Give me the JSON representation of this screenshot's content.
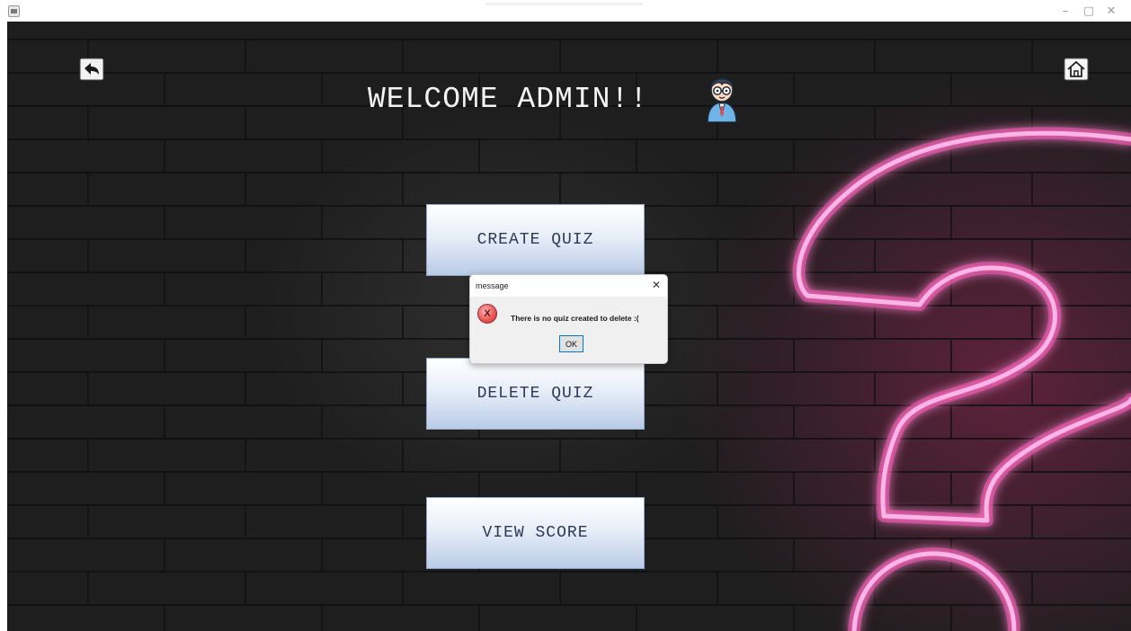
{
  "window": {
    "minimize_glyph": "–",
    "maximize_glyph": "▢",
    "close_glyph": "✕"
  },
  "header": {
    "title": "WELCOME ADMIN!!",
    "back_icon": "back-arrow-icon",
    "home_icon": "home-icon",
    "avatar_icon": "admin-avatar-icon"
  },
  "menu": {
    "create_quiz": "CREATE QUIZ",
    "delete_quiz": "DELETE QUIZ",
    "view_score": "VIEW SCORE"
  },
  "dialog": {
    "title": "message",
    "close_glyph": "✕",
    "icon": "error-icon",
    "icon_glyph": "X",
    "message": "There is no quiz created to delete :(",
    "ok_label": "OK"
  },
  "colors": {
    "background": "#1e1e1e",
    "neon_pink": "#ff5cc0",
    "button_text": "#2d3a55"
  }
}
